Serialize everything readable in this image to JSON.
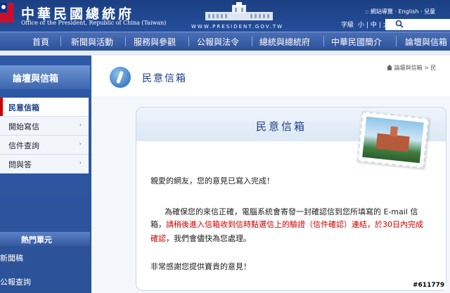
{
  "header": {
    "title": "中華民國總統府",
    "subtitle": "Office of the President, Republic of China (Taiwan)",
    "url": "WWW.PRESIDENT.GOV.TW",
    "top_links": ":: 網站導覽 · English · 兒童",
    "font_size": {
      "label": "字級",
      "small": "小",
      "medium": "中",
      "large": "大"
    }
  },
  "nav": {
    "items": [
      "首頁",
      "新聞與活動",
      "服務與參觀",
      "公報與法令",
      "總統與總統府",
      "中華民國簡介",
      "論壇與信箱"
    ]
  },
  "sidebar": {
    "title": "論壇與信箱",
    "items": [
      {
        "label": "民意信箱",
        "arrow": ""
      },
      {
        "label": "開始寫信",
        "arrow": "›"
      },
      {
        "label": "信件查詢",
        "arrow": "›"
      },
      {
        "label": "問與答",
        "arrow": "›"
      }
    ],
    "hot_title": "熱門單元",
    "hot_items": [
      "新聞稿",
      "公報查詢"
    ]
  },
  "main": {
    "page_title": "民意信箱",
    "breadcrumb": "論壇與信箱 > 民",
    "card_title": "民意信箱",
    "greeting": "親愛的網友，您的意見已寫入完成！",
    "para1_a": "為確保您的來信正確，電腦系統會寄發一封確認信到您所填寫的 E-mail 信",
    "para1_b": "箱，",
    "para1_red1": "請稍後進入信箱收到信時點選信上的驗證（信件確認）連結，於30日內完成",
    "para1_red2": "確認",
    "para1_c": "，我們會儘快為您處理。",
    "thanks": "非常感謝您提供寶貴的意見！"
  },
  "watermark": "#611779"
}
